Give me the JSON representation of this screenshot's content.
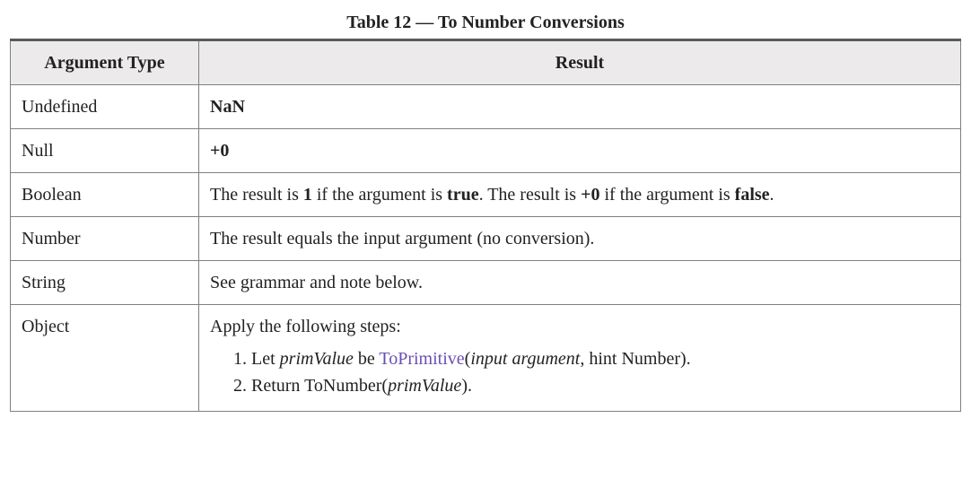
{
  "caption": "Table 12 — To Number Conversions",
  "headers": {
    "argtype": "Argument Type",
    "result": "Result"
  },
  "rows": {
    "undefined": {
      "type": "Undefined",
      "result": "NaN"
    },
    "null": {
      "type": "Null",
      "result": "+0"
    },
    "boolean": {
      "type": "Boolean",
      "p1": "The result is ",
      "one": "1",
      "p2": " if the argument is ",
      "true": "true",
      "p3": ". The result is ",
      "zero": "+0",
      "p4": " if the argument is ",
      "false": "false",
      "p5": "."
    },
    "number": {
      "type": "Number",
      "result": "The result equals the input argument (no conversion)."
    },
    "string": {
      "type": "String",
      "result": "See grammar and note below."
    },
    "object": {
      "type": "Object",
      "intro": "Apply the following steps:",
      "step1": {
        "a": "Let ",
        "primValue": "primValue",
        "b": " be ",
        "toPrimitive": "ToPrimitive",
        "c": "(",
        "inputArg": "input argument",
        "d": ", hint Number)."
      },
      "step2": {
        "a": "Return ToNumber(",
        "primValue": "primValue",
        "b": ")."
      }
    }
  },
  "chart_data": {
    "type": "table",
    "title": "Table 12 — To Number Conversions",
    "columns": [
      "Argument Type",
      "Result"
    ],
    "rows": [
      [
        "Undefined",
        "NaN"
      ],
      [
        "Null",
        "+0"
      ],
      [
        "Boolean",
        "The result is 1 if the argument is true. The result is +0 if the argument is false."
      ],
      [
        "Number",
        "The result equals the input argument (no conversion)."
      ],
      [
        "String",
        "See grammar and note below."
      ],
      [
        "Object",
        "Apply the following steps: 1. Let primValue be ToPrimitive(input argument, hint Number). 2. Return ToNumber(primValue)."
      ]
    ]
  }
}
